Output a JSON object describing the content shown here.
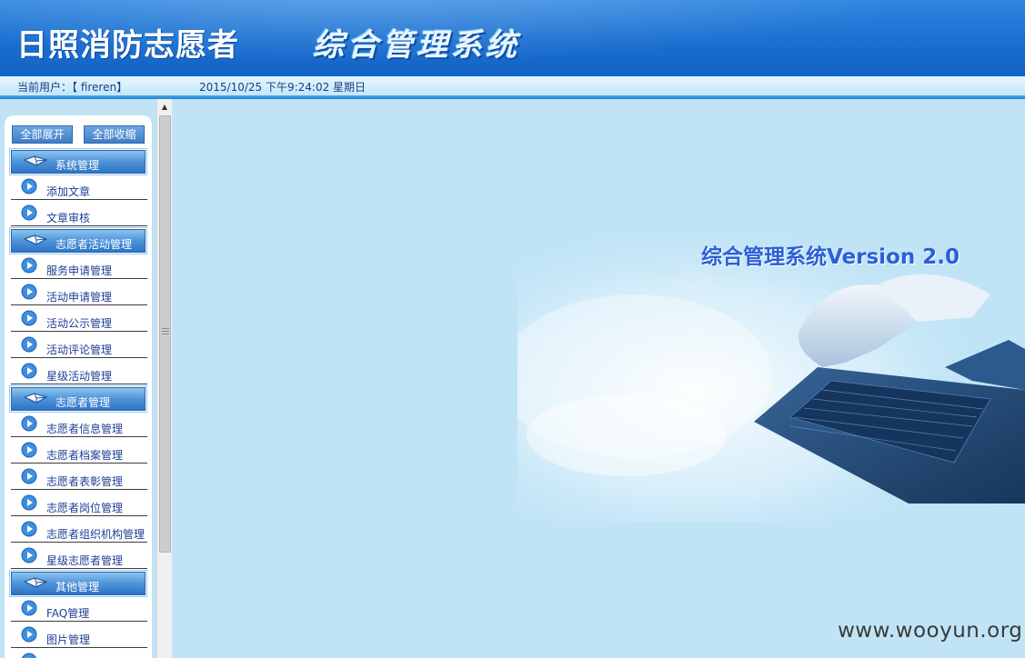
{
  "header": {
    "site_title": "日照消防志愿者",
    "system_title": "综合管理系统"
  },
  "infobar": {
    "user": "当前用户：【 fireren】",
    "datetime": "2015/10/25 下午9:24:02 星期日"
  },
  "sidebar": {
    "expand_all": "全部展开",
    "collapse_all": "全部收缩",
    "groups": [
      {
        "title": "系统管理",
        "items": [
          "添加文章",
          "文章审核"
        ]
      },
      {
        "title": "志愿者活动管理",
        "items": [
          "服务申请管理",
          "活动申请管理",
          "活动公示管理",
          "活动评论管理",
          "星级活动管理"
        ]
      },
      {
        "title": "志愿者管理",
        "items": [
          "志愿者信息管理",
          "志愿者档案管理",
          "志愿者表彰管理",
          "志愿者岗位管理",
          "志愿者组织机构管理",
          "星级志愿者管理"
        ]
      },
      {
        "title": "其他管理",
        "items": [
          "FAQ管理",
          "图片管理"
        ]
      }
    ]
  },
  "main": {
    "banner_title": "综合管理系统Version 2.0",
    "watermark": "www.wooyun.org"
  },
  "colors": {
    "header": "#1a6fd0",
    "background": "#c0e4f6",
    "link": "#1f3f94",
    "banner_title": "#2b5fd6"
  }
}
